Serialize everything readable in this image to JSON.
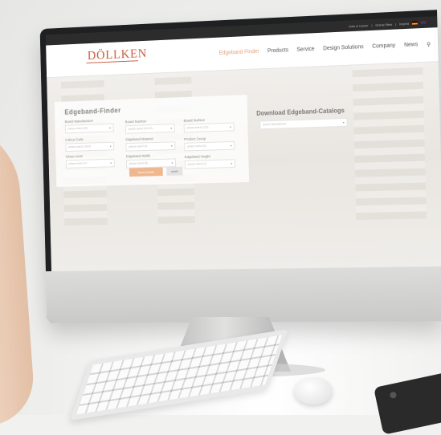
{
  "topbar": {
    "links": [
      "Jobs & Career",
      "Global Sites",
      "Imprint"
    ]
  },
  "brand": {
    "logo": "DÖLLKEN",
    "accent": "#c75b3d"
  },
  "nav": {
    "items": [
      {
        "label": "Edgeband Finder",
        "active": true
      },
      {
        "label": "Products"
      },
      {
        "label": "Service"
      },
      {
        "label": "Design Solutions"
      },
      {
        "label": "Company"
      },
      {
        "label": "News"
      }
    ]
  },
  "finder": {
    "title": "Edgeband-Finder",
    "fields": [
      {
        "label": "Board Manufacturer",
        "placeholder": "please select (48)"
      },
      {
        "label": "Board Number",
        "placeholder": "please select (11413)"
      },
      {
        "label": "Board Surface",
        "placeholder": "please select (112)"
      },
      {
        "label": "Colour Code",
        "placeholder": "please select (1424)"
      },
      {
        "label": "Edgeband Material",
        "placeholder": "please select (6)"
      },
      {
        "label": "Product Group",
        "placeholder": "please select (8)"
      },
      {
        "label": "Gloss Level",
        "placeholder": "please select (7)"
      },
      {
        "label": "Edgeband Width",
        "placeholder": "please select (8)"
      },
      {
        "label": "Edgeband Height",
        "placeholder": "please select (7)"
      }
    ],
    "show_results": "show results",
    "reset": "reset",
    "button_color": "#f0b78f"
  },
  "download": {
    "title": "Download Edgeband-Catalogs",
    "placeholder": "Select Manufacturer"
  }
}
